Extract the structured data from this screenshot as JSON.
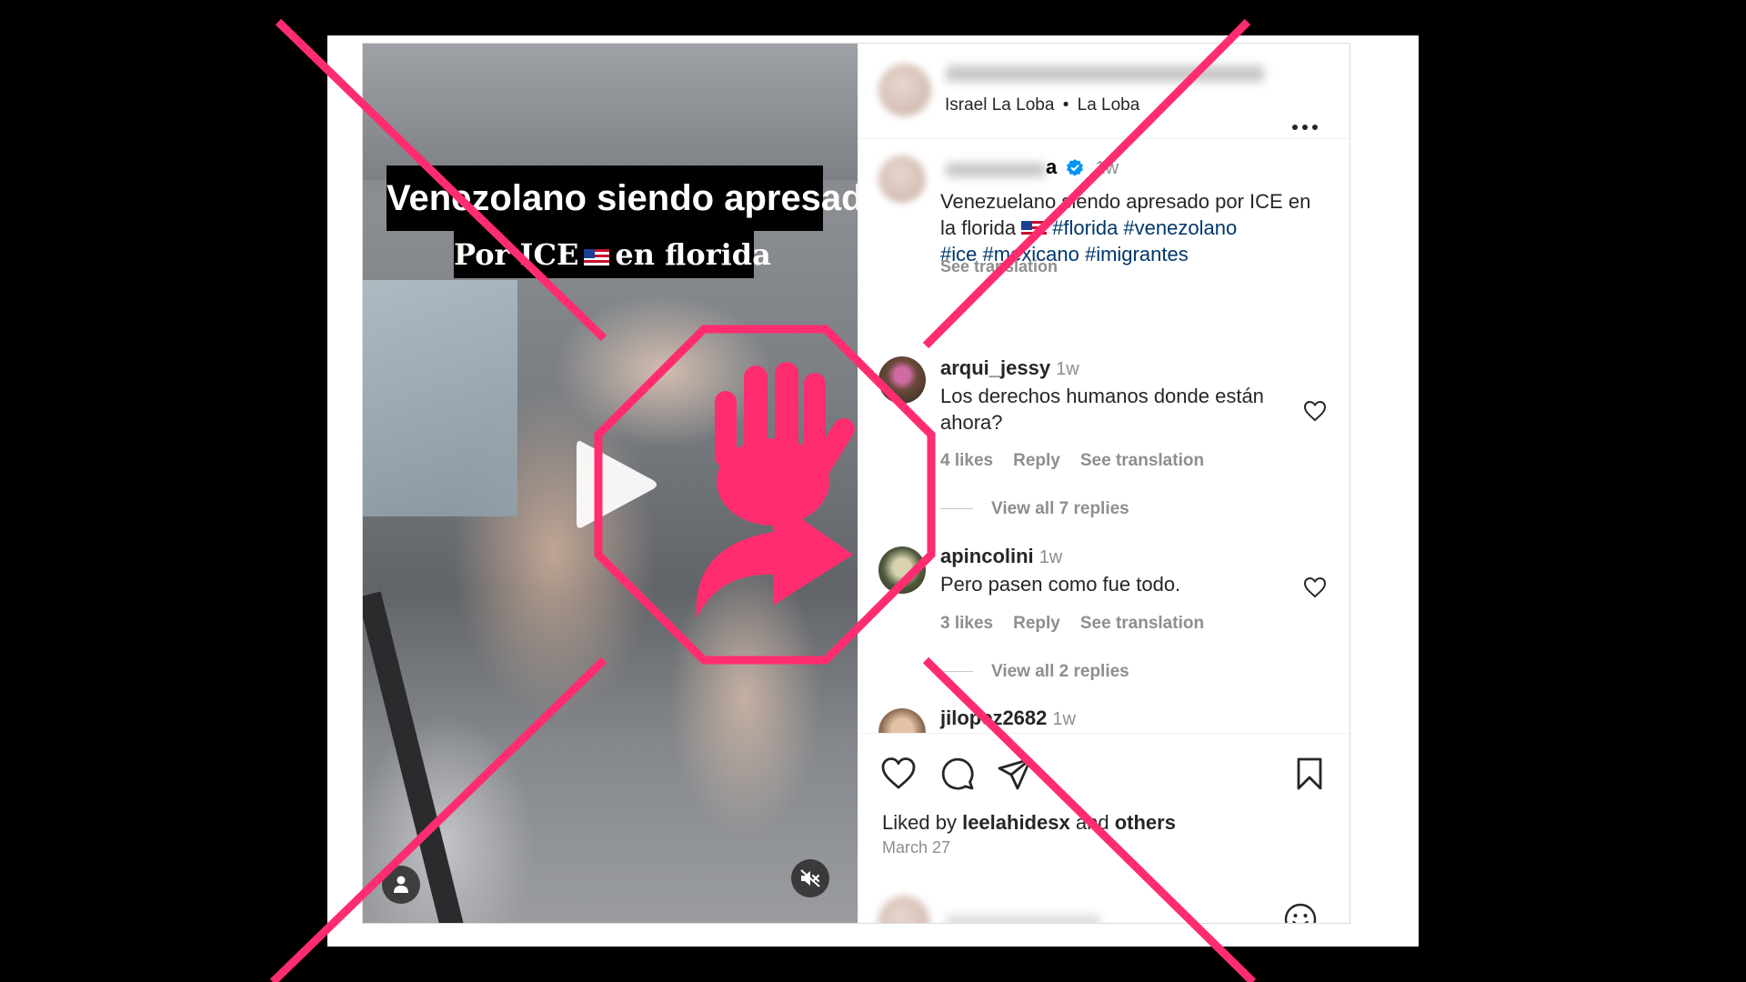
{
  "video": {
    "caption_line1": "Venezolano siendo  apresado",
    "caption_line2_a": "Por ICE",
    "caption_line2_b": "en florida",
    "icons": [
      "play-icon",
      "person-tag-icon",
      "mute-icon"
    ]
  },
  "post_header": {
    "audio_artist": "Israel La Loba",
    "audio_separator": "•",
    "audio_track": "La Loba",
    "more_icon": "more-horizontal-icon"
  },
  "caption": {
    "username_suffix": "a",
    "time": "1w",
    "text_1": "Venezuelano siendo apresado por ICE en la florida",
    "hashtags_line1": "#florida #venezolano",
    "hashtags_line2": "#ice #mexicano #imigrantes",
    "see_translation": "See translation"
  },
  "comments": [
    {
      "username": "arqui_jessy",
      "time": "1w",
      "text": "Los derechos humanos donde están ahora?",
      "likes": "4 likes",
      "reply": "Reply",
      "see_translation": "See translation",
      "view_replies": "View all 7 replies"
    },
    {
      "username": "apincolini",
      "time": "1w",
      "text": "Pero pasen como fue todo.",
      "likes": "3 likes",
      "reply": "Reply",
      "see_translation": "See translation",
      "view_replies": "View all 2 replies"
    },
    {
      "username": "jilopez2682",
      "time": "1w"
    }
  ],
  "actions": {
    "liked_by_prefix": "Liked by",
    "liked_by_user": "leelahidesx",
    "liked_by_and": "and",
    "liked_by_others": "others",
    "date": "March 27",
    "icons": [
      "heart-icon",
      "comment-icon",
      "share-icon",
      "bookmark-icon",
      "emoji-icon"
    ]
  },
  "colors": {
    "overlay_pink": "#ff2d6f",
    "text_primary": "#262626",
    "text_secondary": "#8e8e8e",
    "hashtag": "#00376b",
    "verified": "#0095f6"
  }
}
